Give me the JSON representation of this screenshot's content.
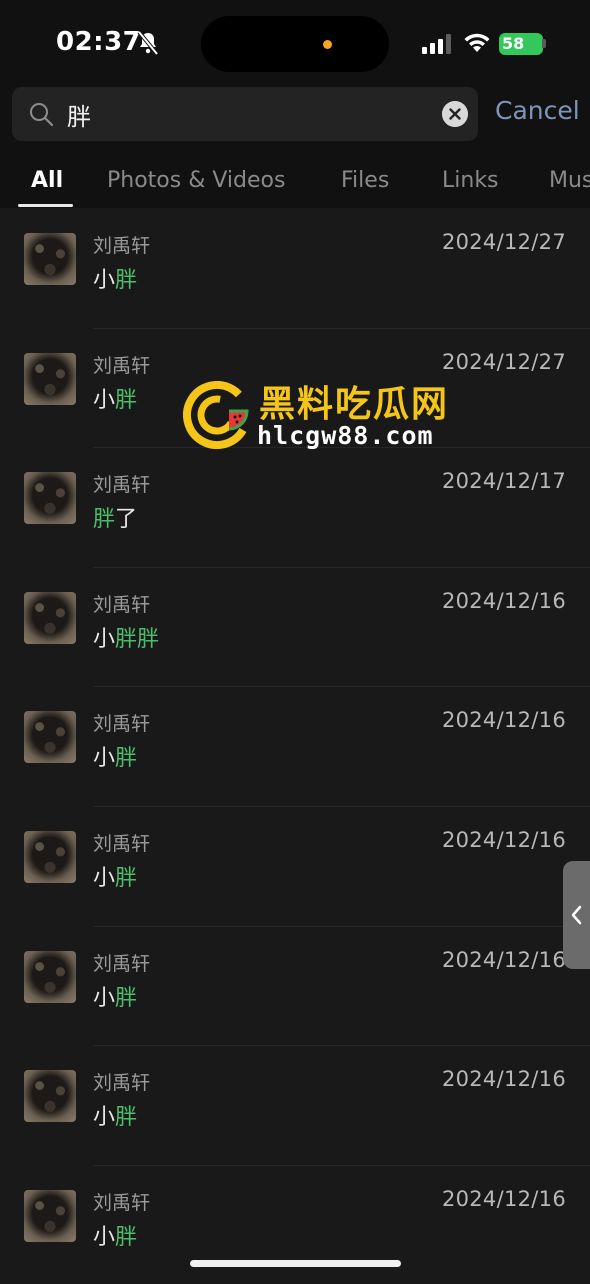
{
  "status_bar": {
    "time": "02:37",
    "battery": "58"
  },
  "search": {
    "query": "胖",
    "cancel_label": "Cancel"
  },
  "tabs": [
    {
      "label": "All",
      "active": true
    },
    {
      "label": "Photos & Videos",
      "active": false
    },
    {
      "label": "Files",
      "active": false
    },
    {
      "label": "Links",
      "active": false
    },
    {
      "label": "Mus",
      "active": false
    }
  ],
  "results": [
    {
      "name": "刘禹轩",
      "date": "2024/12/27",
      "pre": "小",
      "match": "胖",
      "post": ""
    },
    {
      "name": "刘禹轩",
      "date": "2024/12/27",
      "pre": "小",
      "match": "胖",
      "post": ""
    },
    {
      "name": "刘禹轩",
      "date": "2024/12/17",
      "pre": "",
      "match": "胖",
      "post": "了"
    },
    {
      "name": "刘禹轩",
      "date": "2024/12/16",
      "pre": "小",
      "match": "胖胖",
      "post": ""
    },
    {
      "name": "刘禹轩",
      "date": "2024/12/16",
      "pre": "小",
      "match": "胖",
      "post": ""
    },
    {
      "name": "刘禹轩",
      "date": "2024/12/16",
      "pre": "小",
      "match": "胖",
      "post": ""
    },
    {
      "name": "刘禹轩",
      "date": "2024/12/16",
      "pre": "小",
      "match": "胖",
      "post": ""
    },
    {
      "name": "刘禹轩",
      "date": "2024/12/16",
      "pre": "小",
      "match": "胖",
      "post": ""
    },
    {
      "name": "刘禹轩",
      "date": "2024/12/16",
      "pre": "小",
      "match": "胖",
      "post": ""
    }
  ],
  "watermark": {
    "title": "黑料吃瓜网",
    "url": "hlcgw88.com"
  },
  "colors": {
    "highlight": "#4cbf6a",
    "cancel": "#7d96b8",
    "watermark_gold": "#f5c518"
  }
}
